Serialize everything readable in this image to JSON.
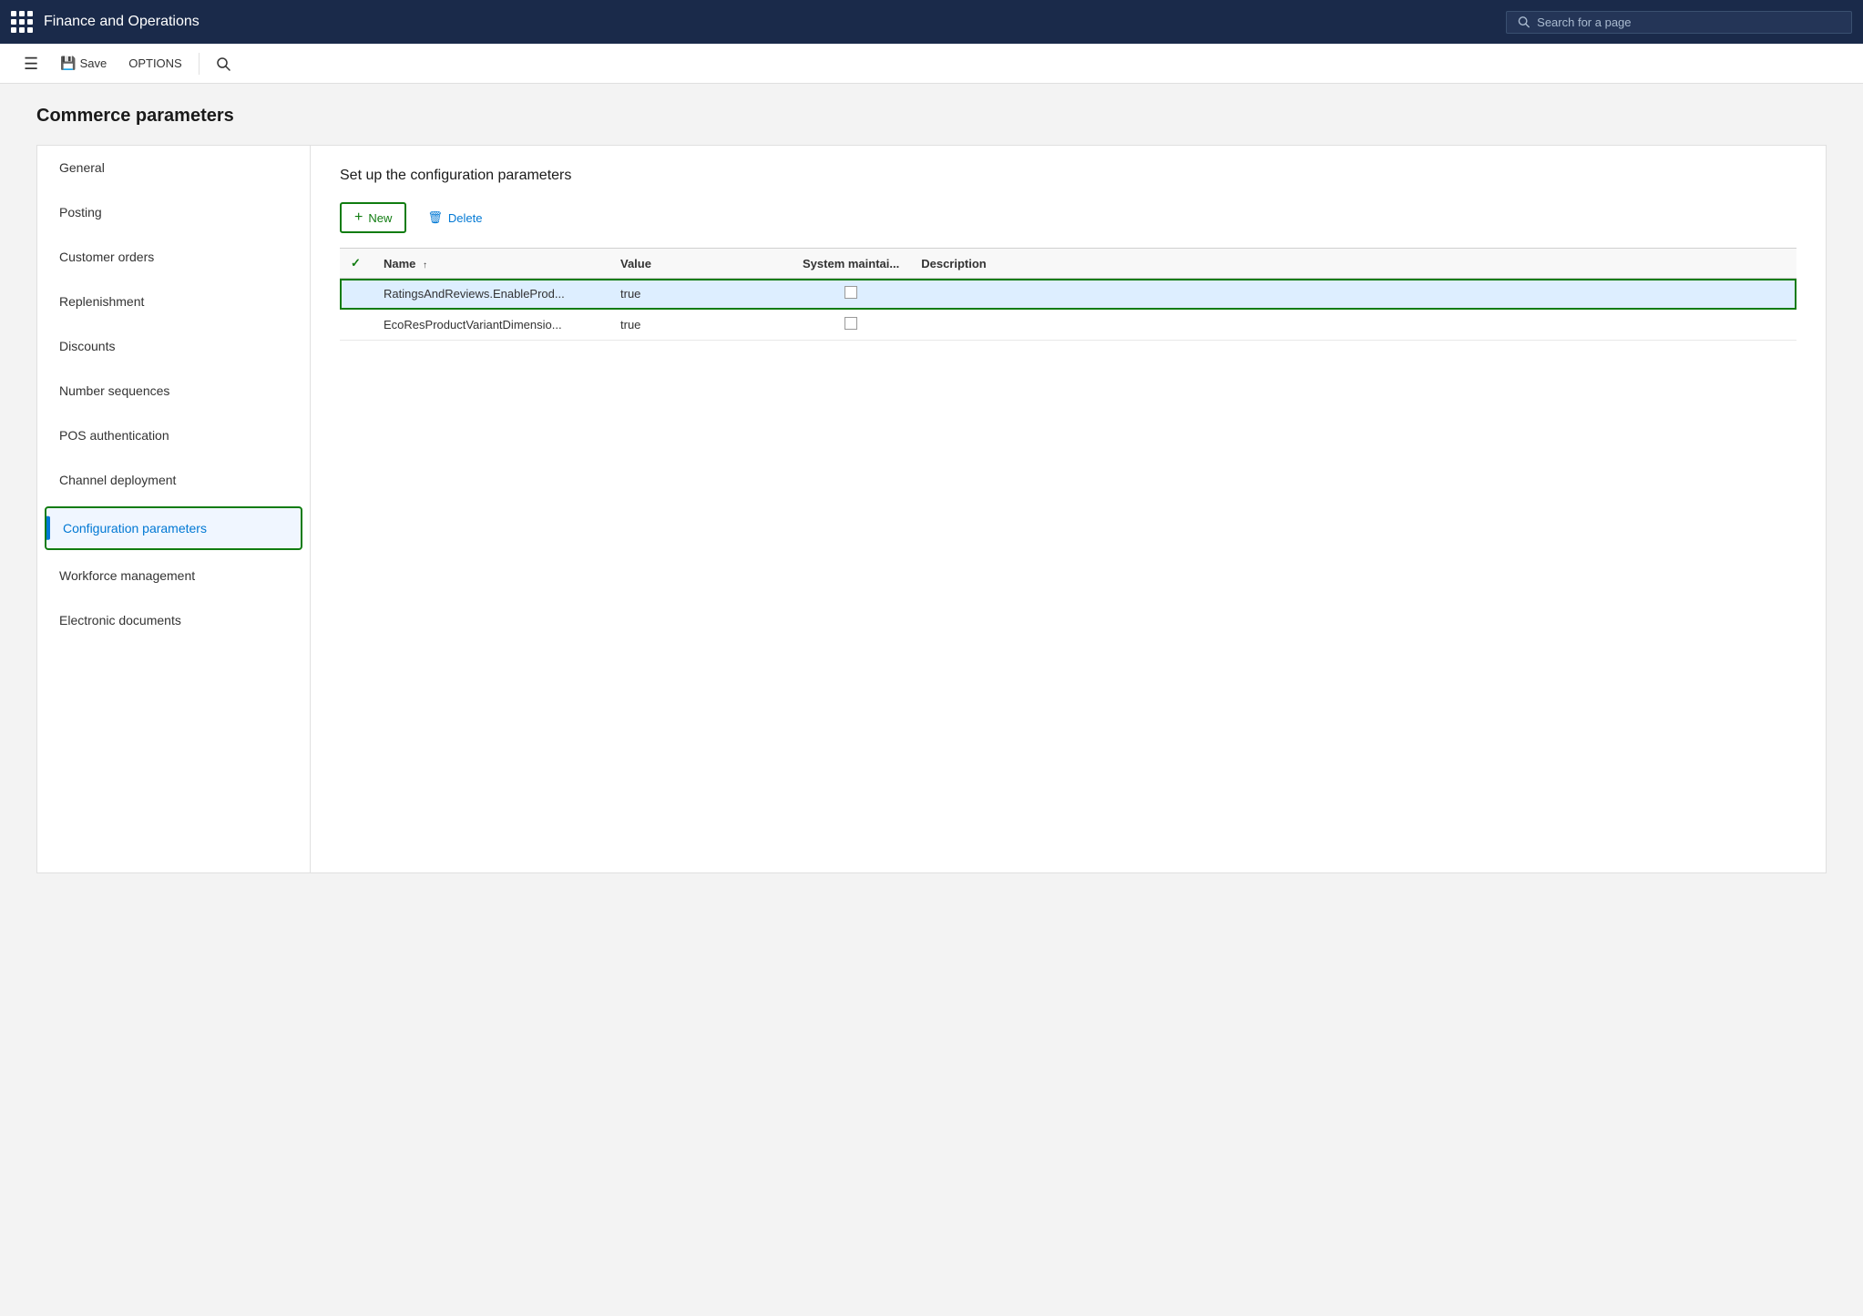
{
  "app": {
    "title": "Finance and Operations",
    "search_placeholder": "Search for a page"
  },
  "toolbar": {
    "save_label": "Save",
    "options_label": "OPTIONS"
  },
  "page": {
    "title": "Commerce parameters",
    "panel_subtitle": "Set up the configuration parameters"
  },
  "sidebar": {
    "items": [
      {
        "id": "general",
        "label": "General",
        "active": false
      },
      {
        "id": "posting",
        "label": "Posting",
        "active": false
      },
      {
        "id": "customer-orders",
        "label": "Customer orders",
        "active": false
      },
      {
        "id": "replenishment",
        "label": "Replenishment",
        "active": false
      },
      {
        "id": "discounts",
        "label": "Discounts",
        "active": false
      },
      {
        "id": "number-sequences",
        "label": "Number sequences",
        "active": false
      },
      {
        "id": "pos-authentication",
        "label": "POS authentication",
        "active": false
      },
      {
        "id": "channel-deployment",
        "label": "Channel deployment",
        "active": false
      },
      {
        "id": "configuration-parameters",
        "label": "Configuration parameters",
        "active": true
      },
      {
        "id": "workforce-management",
        "label": "Workforce management",
        "active": false
      },
      {
        "id": "electronic-documents",
        "label": "Electronic documents",
        "active": false
      }
    ]
  },
  "actions": {
    "new_label": "New",
    "delete_label": "Delete"
  },
  "table": {
    "columns": [
      {
        "id": "check",
        "label": ""
      },
      {
        "id": "name",
        "label": "Name",
        "sorted": "asc"
      },
      {
        "id": "value",
        "label": "Value"
      },
      {
        "id": "system",
        "label": "System maintai..."
      },
      {
        "id": "description",
        "label": "Description"
      }
    ],
    "rows": [
      {
        "id": "row1",
        "selected": true,
        "name": "RatingsAndReviews.EnableProd...",
        "value": "true",
        "system_maintained": false,
        "description": ""
      },
      {
        "id": "row2",
        "selected": false,
        "name": "EcoResProductVariantDimensio...",
        "value": "true",
        "system_maintained": false,
        "description": ""
      }
    ]
  }
}
